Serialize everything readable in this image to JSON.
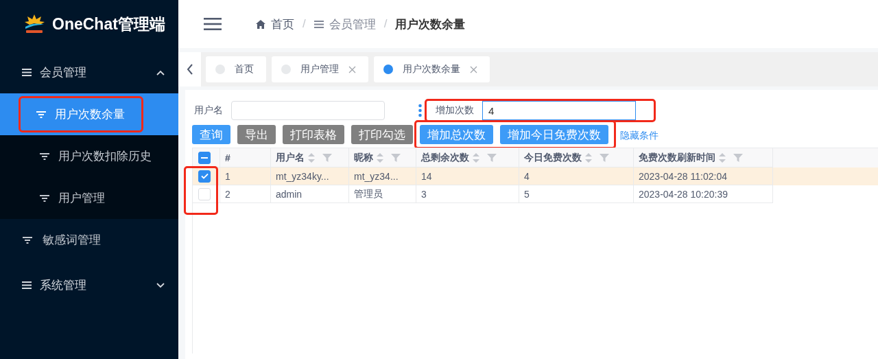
{
  "app": {
    "title": "OneChat管理端"
  },
  "sidebar": {
    "items": [
      {
        "label": "会员管理",
        "kind": "group",
        "expanded": true,
        "children": [
          {
            "label": "用户次数余量",
            "selected": true,
            "highlighted": true
          },
          {
            "label": "用户次数扣除历史",
            "selected": false,
            "highlighted": false
          },
          {
            "label": "用户管理",
            "selected": false,
            "highlighted": false
          }
        ]
      },
      {
        "label": "敏感词管理",
        "kind": "leaf",
        "selected": false
      },
      {
        "label": "系统管理",
        "kind": "group",
        "expanded": false
      }
    ]
  },
  "breadcrumb": [
    {
      "label": "首页",
      "kind": "home"
    },
    {
      "separator": "/",
      "label": "会员管理",
      "kind": "menu"
    },
    {
      "separator": "/",
      "label": "用户次数余量",
      "kind": "current"
    }
  ],
  "tabs": [
    {
      "label": "首页",
      "selected": false,
      "closable": false
    },
    {
      "label": "用户管理",
      "selected": false,
      "closable": true
    },
    {
      "label": "用户次数余量",
      "selected": true,
      "closable": true
    }
  ],
  "filters": [
    {
      "label": "用户名",
      "focused": false,
      "highlighted": false
    },
    {
      "label": "增加次数",
      "value": "4",
      "focused": true,
      "highlighted": true
    }
  ],
  "button_groups": [
    {
      "highlighted": false,
      "buttons": [
        {
          "label": "查询",
          "kind": "primary"
        },
        {
          "label": "导出",
          "kind": "secondary"
        },
        {
          "label": "打印表格",
          "kind": "secondary"
        },
        {
          "label": "打印勾选",
          "kind": "secondary"
        }
      ]
    },
    {
      "highlighted": true,
      "buttons": [
        {
          "label": "增加总次数",
          "kind": "primary"
        },
        {
          "label": "增加今日免费次数",
          "kind": "primary"
        }
      ]
    }
  ],
  "toggle_link": "隐藏条件",
  "table": {
    "select_all_indeterminate": true,
    "checkbox_column_highlighted": true,
    "columns": [
      {
        "label": "#",
        "sortable": false
      },
      {
        "label": "用户名",
        "sortable": true
      },
      {
        "label": "昵称",
        "sortable": true
      },
      {
        "label": "总剩余次数",
        "sortable": true
      },
      {
        "label": "今日免费次数",
        "sortable": true
      },
      {
        "label": "免费次数刷新时间",
        "sortable": true
      }
    ],
    "rows": [
      {
        "selected": true,
        "cells": [
          "1",
          "mt_yz34ky...",
          "mt_yz34...",
          "14",
          "4",
          "2023-04-28 11:02:04"
        ]
      },
      {
        "selected": false,
        "cells": [
          "2",
          "admin",
          "管理员",
          "3",
          "5",
          "2023-04-28 10:20:39"
        ]
      }
    ]
  }
}
